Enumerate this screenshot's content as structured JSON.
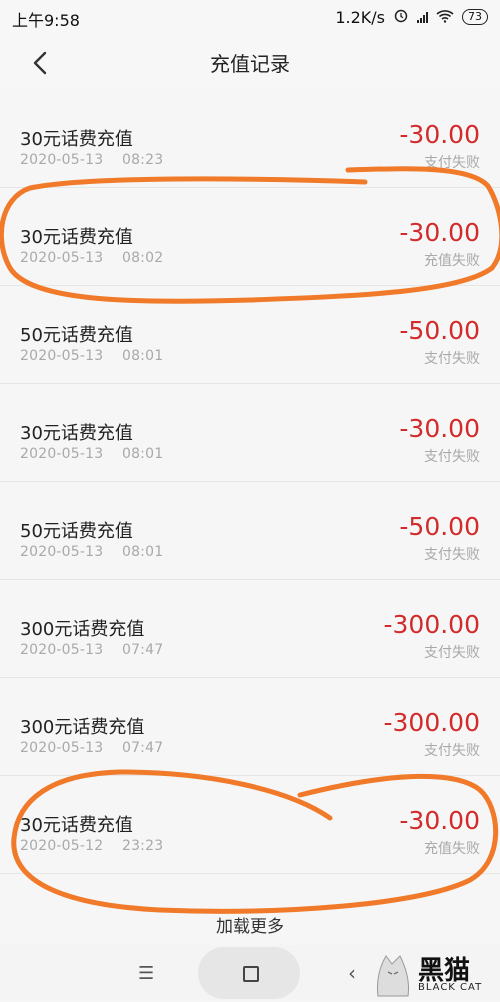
{
  "status_bar": {
    "time": "上午9:58",
    "net_speed": "1.2K/s",
    "battery": "73",
    "icons": [
      "alarm-icon",
      "hd-icon",
      "signal-icon",
      "wifi-icon",
      "battery-icon"
    ]
  },
  "header": {
    "title": "充值记录",
    "back_icon": "chevron-left-icon"
  },
  "records": [
    {
      "name": "30元话费充值",
      "date": "2020-05-13    08:23",
      "amount": "-30.00",
      "status": "支付失败"
    },
    {
      "name": "30元话费充值",
      "date": "2020-05-13    08:02",
      "amount": "-30.00",
      "status": "充值失败"
    },
    {
      "name": "50元话费充值",
      "date": "2020-05-13    08:01",
      "amount": "-50.00",
      "status": "支付失败"
    },
    {
      "name": "30元话费充值",
      "date": "2020-05-13    08:01",
      "amount": "-30.00",
      "status": "支付失败"
    },
    {
      "name": "50元话费充值",
      "date": "2020-05-13    08:01",
      "amount": "-50.00",
      "status": "支付失败"
    },
    {
      "name": "300元话费充值",
      "date": "2020-05-13    07:47",
      "amount": "-300.00",
      "status": "支付失败"
    },
    {
      "name": "300元话费充值",
      "date": "2020-05-13    07:47",
      "amount": "-300.00",
      "status": "支付失败"
    },
    {
      "name": "30元话费充值",
      "date": "2020-05-12    23:23",
      "amount": "-30.00",
      "status": "充值失败"
    }
  ],
  "load_more": "加载更多",
  "nav_bar": {
    "icons": [
      "menu-icon",
      "home-icon",
      "back-icon"
    ]
  },
  "watermark": {
    "cn": "黑猫",
    "en": "BLACK CAT"
  },
  "colors": {
    "amount": "#d22b2b",
    "annotation": "#f07a2a",
    "background": "#f6f6f6"
  }
}
